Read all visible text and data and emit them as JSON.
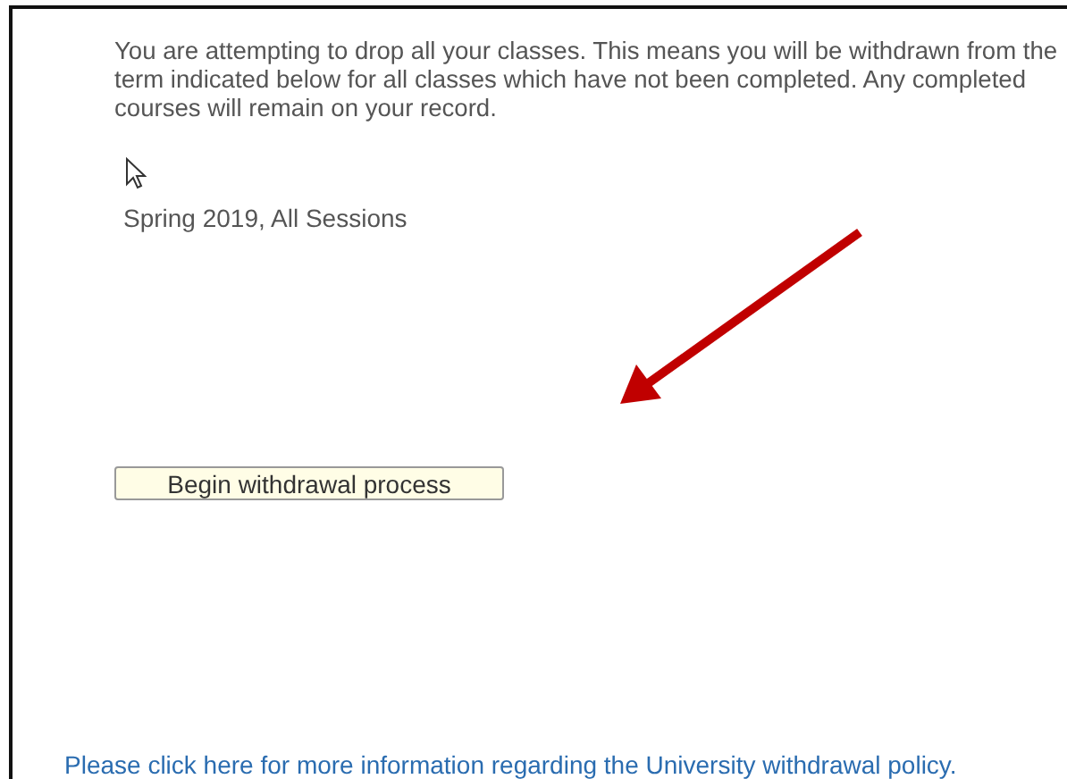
{
  "notice": "You are attempting to drop all your classes. This means you will be withdrawn from the term indicated below for all classes which have not been completed. Any completed courses will remain on your record.",
  "term": "Spring 2019, All Sessions",
  "button": "Begin withdrawal process",
  "policy_link": "Please click here for more information regarding the University withdrawal policy."
}
